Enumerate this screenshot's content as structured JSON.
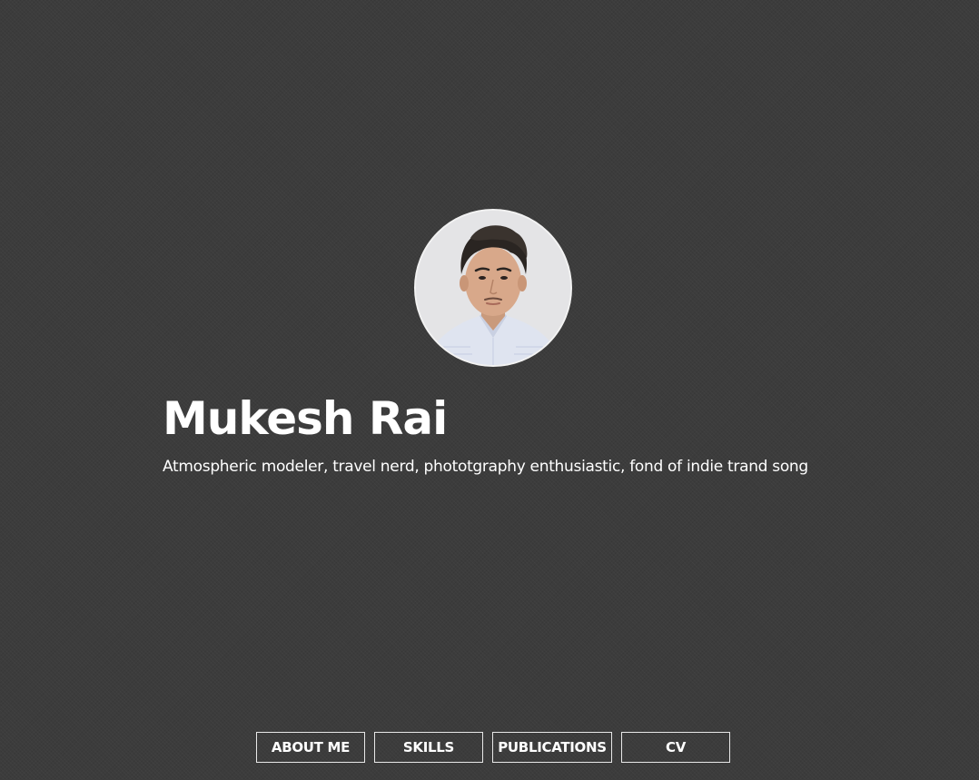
{
  "profile": {
    "name": "Mukesh Rai",
    "tagline": "Atmospheric modeler, travel nerd, phototgraphy enthusiastic, fond of indie trand song",
    "avatar_icon": "profile-photo"
  },
  "nav": {
    "items": [
      {
        "label": "ABOUT ME"
      },
      {
        "label": "SKILLS"
      },
      {
        "label": "PUBLICATIONS"
      },
      {
        "label": "CV"
      }
    ]
  },
  "colors": {
    "background": "#3c3c3c",
    "text": "#ffffff",
    "button_border": "#e8e8e8"
  }
}
